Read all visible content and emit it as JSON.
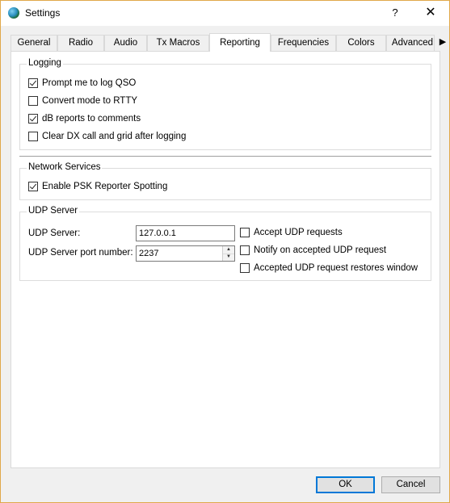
{
  "window": {
    "title": "Settings",
    "help_glyph": "?",
    "close_glyph": "✕"
  },
  "tabs": [
    {
      "label": "General",
      "active": false
    },
    {
      "label": "Radio",
      "active": false
    },
    {
      "label": "Audio",
      "active": false
    },
    {
      "label": "Tx Macros",
      "active": false
    },
    {
      "label": "Reporting",
      "active": true
    },
    {
      "label": "Frequencies",
      "active": false
    },
    {
      "label": "Colors",
      "active": false
    },
    {
      "label": "Advanced",
      "active": false
    }
  ],
  "tab_scroll_glyph": "▶",
  "logging": {
    "title": "Logging",
    "items": [
      {
        "label": "Prompt me to log QSO",
        "checked": true
      },
      {
        "label": "Convert mode to RTTY",
        "checked": false
      },
      {
        "label": "dB reports to comments",
        "checked": true
      },
      {
        "label": "Clear DX call and grid after logging",
        "checked": false
      }
    ]
  },
  "network": {
    "title": "Network Services",
    "items": [
      {
        "label": "Enable PSK Reporter Spotting",
        "checked": true
      }
    ]
  },
  "udp": {
    "title": "UDP Server",
    "server_label": "UDP Server:",
    "server_value": "127.0.0.1",
    "port_label": "UDP Server port number:",
    "port_value": "2237",
    "options": [
      {
        "label": "Accept UDP requests",
        "checked": false
      },
      {
        "label": "Notify on accepted UDP request",
        "checked": false
      },
      {
        "label": "Accepted UDP request restores window",
        "checked": false
      }
    ]
  },
  "buttons": {
    "ok": "OK",
    "cancel": "Cancel"
  }
}
